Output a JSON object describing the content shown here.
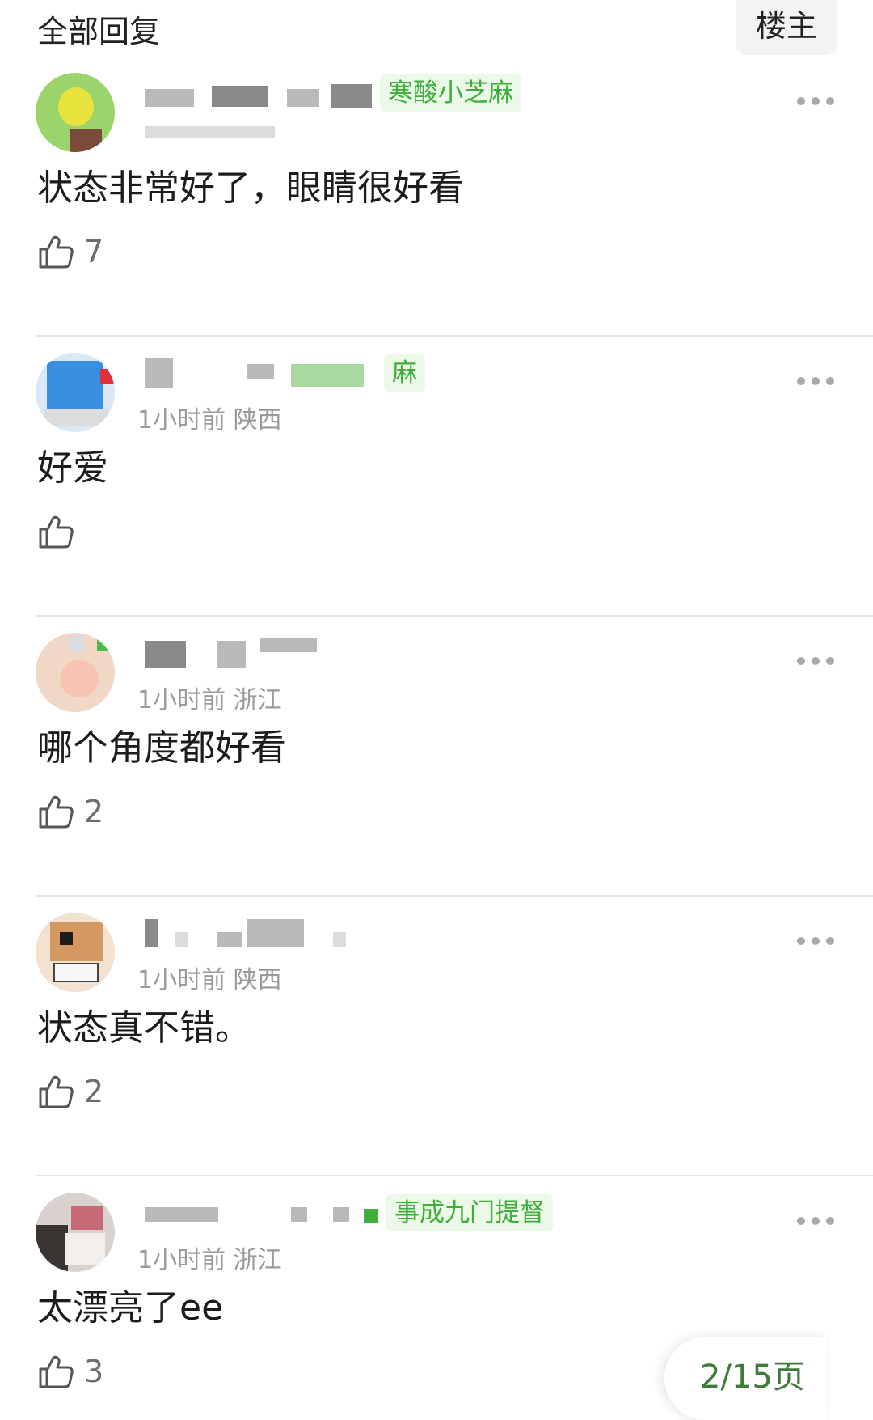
{
  "header": {
    "title": "全部回复",
    "op_filter_label": "楼主"
  },
  "comments": [
    {
      "badge": "寒酸小芝麻",
      "meta": "",
      "content": "状态非常好了，眼睛很好看",
      "likes": "7"
    },
    {
      "badge": "麻",
      "meta": "1小时前 陕西",
      "content": "好爱",
      "likes": ""
    },
    {
      "badge": "",
      "meta": "1小时前 浙江",
      "content": "哪个角度都好看",
      "likes": "2"
    },
    {
      "badge": "",
      "meta": "1小时前 陕西",
      "content": "状态真不错。",
      "likes": "2"
    },
    {
      "badge": "事成九门提督",
      "meta": "1小时前 浙江",
      "content": "太漂亮了ee",
      "likes": "3"
    }
  ],
  "pager": {
    "label": "2/15页"
  },
  "icons": {
    "more": "more-dots-icon",
    "like": "thumbs-up-icon"
  },
  "colors": {
    "badge_text": "#3fae3a",
    "badge_bg": "#ecf8e8",
    "meta_text": "#9a9a9a"
  }
}
